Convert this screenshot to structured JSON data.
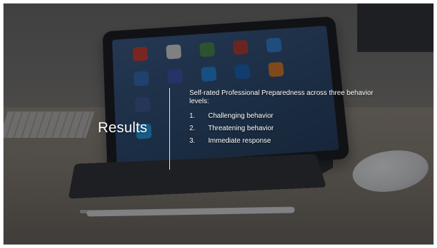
{
  "slide": {
    "title": "Results",
    "intro": "Self-rated Professional Preparedness across three behavior levels:",
    "items": [
      {
        "number": "1.",
        "label": "Challenging behavior"
      },
      {
        "number": "2.",
        "label": "Threatening behavior"
      },
      {
        "number": "3.",
        "label": "Immediate response"
      }
    ]
  },
  "colors": {
    "text": "#ffffff",
    "overlay": "#0f1114",
    "divider": "#e8e8e8"
  }
}
